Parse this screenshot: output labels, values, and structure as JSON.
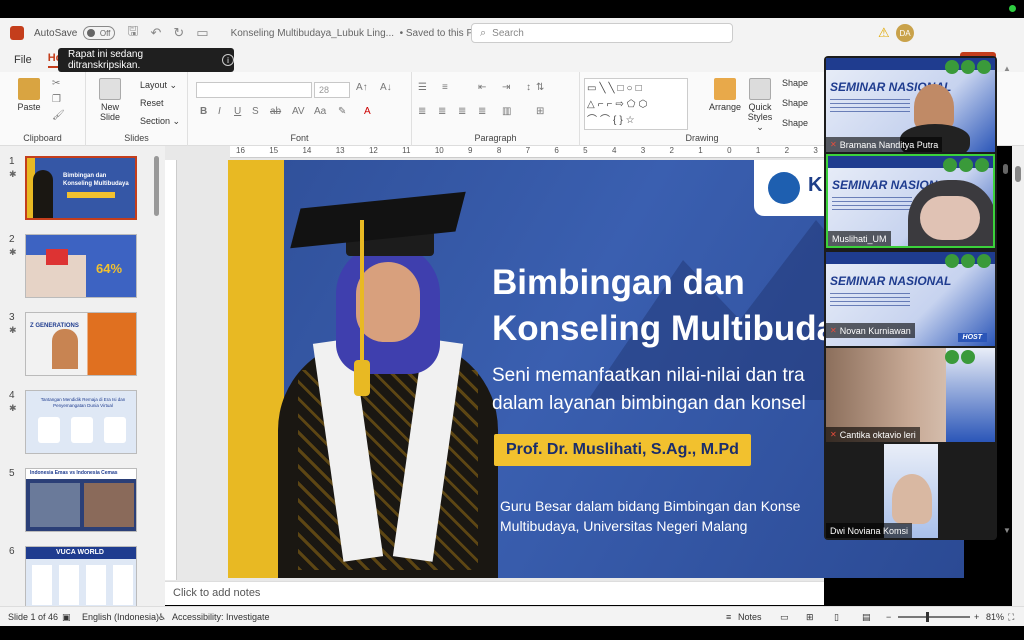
{
  "titlebar": {
    "autosave_label": "AutoSave",
    "autosave_state": "Off",
    "document_name": "Konseling Multibudaya_Lubuk Ling...",
    "save_status": "• Saved to this PC ⌄",
    "search_placeholder": "Search",
    "user_initials": "DA"
  },
  "ribbon_tabs": [
    {
      "label": "File"
    },
    {
      "label": "Ho"
    }
  ],
  "share_label": "re",
  "banner": {
    "text": "Rapat ini sedang ditranskripsikan."
  },
  "ribbon": {
    "clipboard": {
      "paste": "Paste",
      "label": "Clipboard"
    },
    "slides": {
      "new_slide": "New Slide",
      "layout": "Layout ⌄",
      "reset": "Reset",
      "section": "Section ⌄",
      "label": "Slides"
    },
    "font": {
      "font_size": "28",
      "label": "Font"
    },
    "paragraph": {
      "label": "Paragraph"
    },
    "drawing": {
      "arrange": "Arrange",
      "quick_styles": "Quick Styles ⌄",
      "shape_fill": "Shape",
      "shape_outline": "Shape",
      "shape_effects": "Shape",
      "label": "Drawing"
    }
  },
  "thumbnails": [
    {
      "number": "1",
      "selected": true,
      "title": "Bimbingan dan Konseling Multibudaya",
      "badge": "",
      "color": "#3557a6"
    },
    {
      "number": "2",
      "selected": false,
      "title": "",
      "badge": "64%",
      "color": "#3d63c2"
    },
    {
      "number": "3",
      "selected": false,
      "title": "Z GENERATIONS",
      "badge": "",
      "color": "#e07020"
    },
    {
      "number": "4",
      "selected": false,
      "title": "Tantangan Mendidik Remaja di Era Isi dan Penyemangatan Dunia Virtual",
      "badge": "",
      "color": "#dfe8f5"
    },
    {
      "number": "5",
      "selected": false,
      "title": "Indonesia Emas vs Indonesia Cemas",
      "badge": "",
      "color": "#2b3f77"
    },
    {
      "number": "6",
      "selected": false,
      "title": "VUCA WORLD",
      "badge": "",
      "color": "#dfe8f5"
    }
  ],
  "ruler": [
    "16",
    "15",
    "14",
    "13",
    "12",
    "11",
    "10",
    "9",
    "8",
    "7",
    "6",
    "5",
    "4",
    "3",
    "2",
    "1",
    "0",
    "1",
    "2",
    "3"
  ],
  "slide": {
    "logo_text": "K",
    "title_line1": "Bimbingan dan",
    "title_line2": "Konseling Multibuda",
    "subtitle_line1": "Seni memanfaatkan nilai-nilai dan tra",
    "subtitle_line2": "dalam layanan bimbingan dan konsel",
    "presenter": "Prof. Dr. Muslihati, S.Ag., M.Pd",
    "desc_line1": "Guru Besar dalam bidang Bimbingan dan Konse",
    "desc_line2": "Multibudaya, Universitas Negeri Malang"
  },
  "notes_placeholder": "Click to add notes",
  "status": {
    "slide_count": "Slide 1 of 46",
    "language": "English (Indonesia)",
    "accessibility": "Accessibility: Investigate",
    "notes": "Notes",
    "zoom": "81%"
  },
  "meeting": {
    "seminar_title": "SEMINAR NASIONAL",
    "host_badge": "HOST",
    "participants": [
      {
        "name": "Bramana Nanditya Putra",
        "muted": true,
        "active": false
      },
      {
        "name": "Muslihati_UM",
        "muted": false,
        "active": true
      },
      {
        "name": "Novan Kurniawan",
        "muted": true,
        "active": false
      },
      {
        "name": "Cantika oktavio leri",
        "muted": true,
        "active": false
      },
      {
        "name": "Dwi Noviana Komsi",
        "muted": false,
        "active": false
      }
    ]
  }
}
